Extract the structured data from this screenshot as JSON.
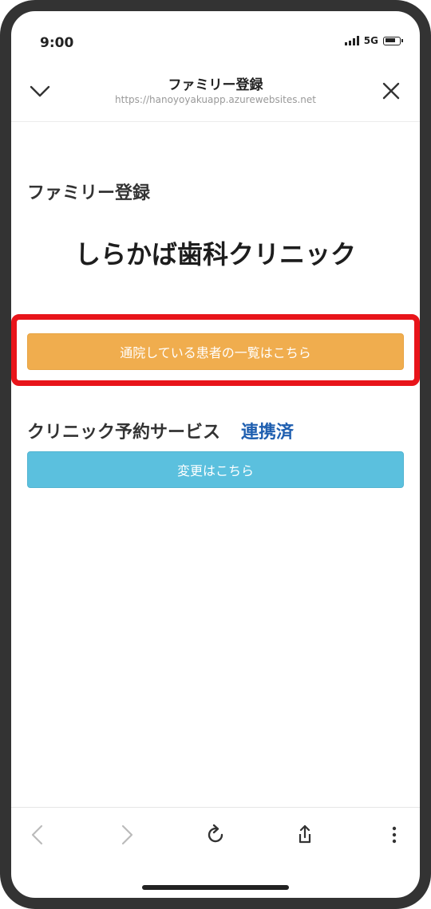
{
  "status_bar": {
    "time": "9:00",
    "network": "5G",
    "icons": [
      "signal-icon",
      "battery-icon"
    ]
  },
  "nav": {
    "title": "ファミリー登録",
    "url": "https://hanoyoyakuapp.azurewebsites.net",
    "left_icon": "chevron-down-icon",
    "right_icon": "close-icon"
  },
  "content": {
    "section_label": "ファミリー登録",
    "clinic_name": "しらかば歯科クリニック",
    "patients_button_label": "通院している患者の一覧はこちら",
    "service_label": "クリニック予約サービス",
    "service_status": "連携済",
    "change_button_label": "変更はこちら"
  },
  "toolbar": {
    "icons": [
      "back-arrow-icon",
      "forward-arrow-icon",
      "reload-icon",
      "share-icon",
      "more-icon"
    ]
  },
  "colors": {
    "highlight": "#e8141a",
    "patients_button": "#f0ad4e",
    "change_button": "#5bc0de",
    "status_link": "#1f5fb0"
  }
}
